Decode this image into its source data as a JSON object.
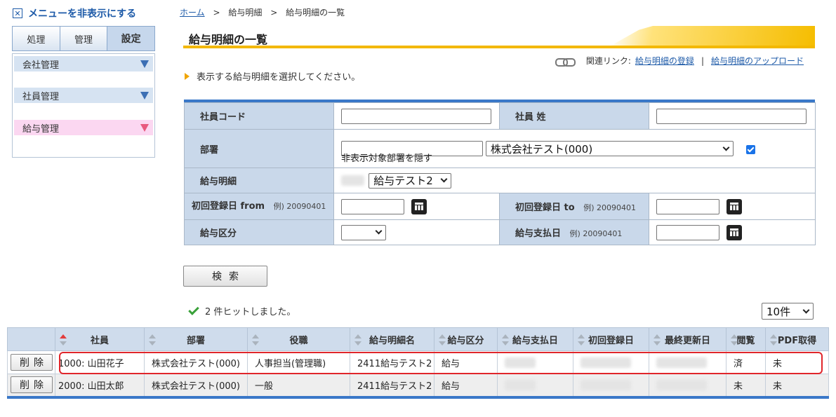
{
  "menu": {
    "toggle_label": "メニューを非表示にする",
    "tabs": [
      {
        "label": "処理"
      },
      {
        "label": "管理"
      },
      {
        "label": "設定"
      }
    ],
    "items": [
      {
        "label": "会社管理"
      },
      {
        "label": "社員管理"
      },
      {
        "label": "給与管理"
      }
    ]
  },
  "breadcrumb": {
    "home": "ホーム",
    "sep": ">",
    "level1": "給与明細",
    "current": "給与明細の一覧"
  },
  "page": {
    "title": "給与明細の一覧",
    "related_label": "関連リンク:",
    "related_links": [
      "給与明細の登録",
      "給与明細のアップロード"
    ],
    "related_divider": "|",
    "instruction": "表示する給与明細を選択してください。"
  },
  "form": {
    "employee_code_label": "社員コード",
    "employee_code_value": "",
    "surname_label": "社員 姓",
    "surname_value": "",
    "department_label": "部署",
    "department_text_value": "",
    "department_select_value": "株式会社テスト(000)",
    "hide_checkbox_label": "非表示対象部署を隠す",
    "payslip_label": "給与明細",
    "payslip_blurred": "2411",
    "payslip_select_value": "給与テスト2",
    "first_reg_from_label": "初回登録日 from",
    "first_reg_from_example": "例) 20090401",
    "first_reg_to_label": "初回登録日 to",
    "first_reg_to_example": "例) 20090401",
    "pay_type_label": "給与区分",
    "pay_type_value": "",
    "pay_date_label": "給与支払日",
    "pay_date_example": "例) 20090401"
  },
  "search": {
    "button_label": "検索",
    "hits_text": "2 件ヒットしました。",
    "per_page_value": "10件"
  },
  "table": {
    "columns": [
      "社員",
      "部署",
      "役職",
      "給与明細名",
      "給与区分",
      "給与支払日",
      "初回登録日",
      "最終更新日",
      "閲覧",
      "PDF取得"
    ],
    "delete_label": "削除",
    "rows": [
      {
        "employee": "1000: 山田花子",
        "department": "株式会社テスト(000)",
        "position": "人事担当(管理職)",
        "payslip": "2411給与テスト2",
        "pay_type": "給与",
        "pay_date": "",
        "first_reg": "",
        "last_update": "",
        "viewed": "済",
        "pdf": "未"
      },
      {
        "employee": "2000: 山田太郎",
        "department": "株式会社テスト(000)",
        "position": "一般",
        "payslip": "2411給与テスト2",
        "pay_type": "給与",
        "pay_date": "",
        "first_reg": "",
        "last_update": "",
        "viewed": "未",
        "pdf": "未"
      }
    ]
  },
  "colors": {
    "accent_blue": "#3a78c8",
    "title_underline": "#f3b800",
    "highlight_red": "#e0262b",
    "label_bg": "#c9d8ea"
  }
}
